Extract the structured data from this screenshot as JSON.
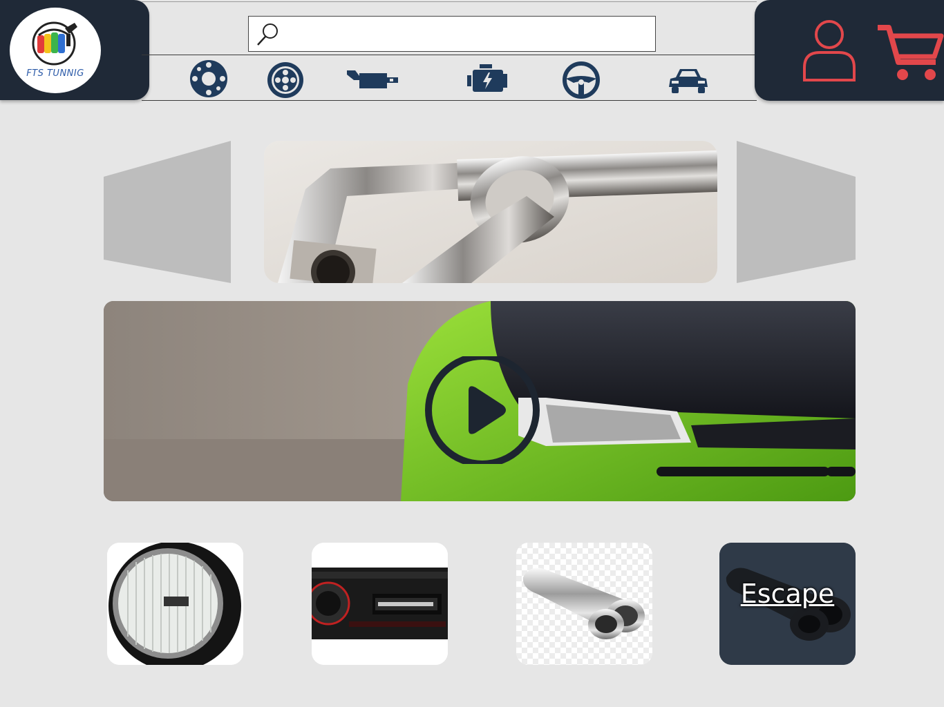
{
  "brand": {
    "name": "FTS TUNNIG"
  },
  "search": {
    "placeholder": "",
    "value": ""
  },
  "header": {
    "categories": [
      {
        "name": "brake-disc-icon"
      },
      {
        "name": "wheel-rim-icon"
      },
      {
        "name": "exhaust-icon"
      },
      {
        "name": "engine-icon"
      },
      {
        "name": "steering-wheel-icon"
      },
      {
        "name": "car-icon"
      }
    ],
    "account_icon": "user-icon",
    "cart_icon": "cart-icon"
  },
  "colors": {
    "panel": "#1f2937",
    "accent": "#e2474b",
    "background": "#e6e6e6",
    "arrow": "#bdbdbd"
  },
  "products": [
    {
      "image": "fog-light"
    },
    {
      "image": "car-stereo"
    },
    {
      "image": "exhaust-tip"
    },
    {
      "label": "Escape"
    }
  ]
}
